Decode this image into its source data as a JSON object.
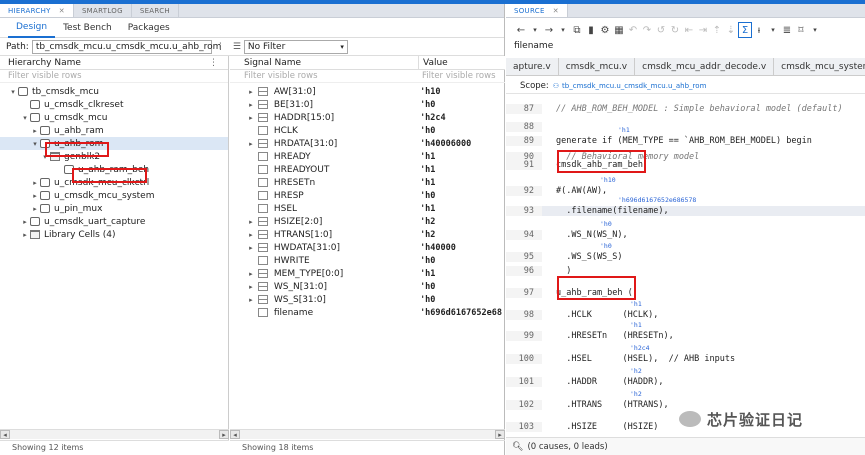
{
  "left_tabs": [
    {
      "label": "HIERARCHY",
      "active": true
    },
    {
      "label": "SMARTLOG",
      "active": false
    },
    {
      "label": "SEARCH",
      "active": false
    }
  ],
  "sub_tabs": [
    {
      "label": "Design",
      "active": true
    },
    {
      "label": "Test Bench",
      "active": false
    },
    {
      "label": "Packages",
      "active": false
    }
  ],
  "path": {
    "label": "Path:",
    "value": "tb_cmsdk_mcu.u_cmsdk_mcu.u_ahb_rom"
  },
  "filter_select": {
    "value": "No Filter"
  },
  "hierarchy": {
    "header": "Hierarchy Name",
    "filter_placeholder": "Filter visible rows",
    "items": [
      {
        "label": "tb_cmsdk_mcu",
        "depth": 0,
        "expander": "▾"
      },
      {
        "label": "u_cmsdk_clkreset",
        "depth": 1,
        "expander": ""
      },
      {
        "label": "u_cmsdk_mcu",
        "depth": 1,
        "expander": "▾"
      },
      {
        "label": "u_ahb_ram",
        "depth": 2,
        "expander": "▸"
      },
      {
        "label": "u_ahb_rom",
        "depth": 2,
        "expander": "▾"
      },
      {
        "label": "genblk2",
        "depth": 3,
        "expander": "▾"
      },
      {
        "label": "u_ahb_ram_beh",
        "depth": 4,
        "expander": ""
      },
      {
        "label": "u_cmsdk_mcu_clkctrl",
        "depth": 2,
        "expander": "▸"
      },
      {
        "label": "u_cmsdk_mcu_system",
        "depth": 2,
        "expander": "▸"
      },
      {
        "label": "u_pin_mux",
        "depth": 2,
        "expander": "▸"
      },
      {
        "label": "u_cmsdk_uart_capture",
        "depth": 1,
        "expander": "▸"
      },
      {
        "label": "Library Cells (4)",
        "depth": 1,
        "expander": "▸"
      }
    ],
    "status": "Showing 12 items"
  },
  "signals": {
    "header_name": "Signal Name",
    "header_value": "Value",
    "filter_placeholder": "Filter visible rows",
    "rows": [
      {
        "name": "AW[31:0]",
        "value": "'h10",
        "bus": true
      },
      {
        "name": "BE[31:0]",
        "value": "'h0",
        "bus": true
      },
      {
        "name": "HADDR[15:0]",
        "value": "'h2c4",
        "bus": true
      },
      {
        "name": "HCLK",
        "value": "'h0",
        "bus": false
      },
      {
        "name": "HRDATA[31:0]",
        "value": "'h40006000",
        "bus": true
      },
      {
        "name": "HREADY",
        "value": "'h1",
        "bus": false
      },
      {
        "name": "HREADYOUT",
        "value": "'h1",
        "bus": false
      },
      {
        "name": "HRESETn",
        "value": "'h1",
        "bus": false
      },
      {
        "name": "HRESP",
        "value": "'h0",
        "bus": false
      },
      {
        "name": "HSEL",
        "value": "'h1",
        "bus": false
      },
      {
        "name": "HSIZE[2:0]",
        "value": "'h2",
        "bus": true
      },
      {
        "name": "HTRANS[1:0]",
        "value": "'h2",
        "bus": true
      },
      {
        "name": "HWDATA[31:0]",
        "value": "'h40000",
        "bus": true
      },
      {
        "name": "HWRITE",
        "value": "'h0",
        "bus": false
      },
      {
        "name": "MEM_TYPE[0:0]",
        "value": "'h1",
        "bus": true
      },
      {
        "name": "WS_N[31:0]",
        "value": "'h0",
        "bus": true
      },
      {
        "name": "WS_S[31:0]",
        "value": "'h0",
        "bus": true
      },
      {
        "name": "filename",
        "value": "'h696d6167652e68",
        "bus": false
      }
    ],
    "status": "Showing 18 items"
  },
  "source": {
    "tab_label": "SOURCE",
    "filename_label": "filename",
    "file_tabs": [
      "apture.v",
      "cmsdk_mcu.v",
      "cmsdk_mcu_addr_decode.v",
      "cmsdk_mcu_syster"
    ],
    "scope_label": "Scope:",
    "scope_value": "tb_cmsdk_mcu.u_cmsdk_mcu.u_ahb_rom",
    "lines": [
      {
        "num": "87",
        "text": "// AHB_ROM_BEH_MODEL : Simple behavioral model (default)"
      },
      {
        "num": "88",
        "text": ""
      },
      {
        "num": "89",
        "text": "generate if (MEM_TYPE == `AHB_ROM_BEH_MODEL) begin"
      },
      {
        "num": "90",
        "text": "  // Behavioral memory model"
      },
      {
        "num": "91",
        "text": "cmsdk_ahb_ram_beh"
      },
      {
        "num": "92",
        "text": "#(.AW(AW),"
      },
      {
        "num": "93",
        "text": "  .filename(filename),"
      },
      {
        "num": "94",
        "text": "  .WS_N(WS_N),"
      },
      {
        "num": "95",
        "text": "  .WS_S(WS_S)"
      },
      {
        "num": "96",
        "text": "  )"
      },
      {
        "num": "97",
        "text": "u_ahb_ram_beh ("
      },
      {
        "num": "98",
        "text": "  .HCLK      (HCLK),"
      },
      {
        "num": "99",
        "text": "  .HRESETn   (HRESETn),"
      },
      {
        "num": "100",
        "text": "  .HSEL      (HSEL),  // AHB inputs"
      },
      {
        "num": "101",
        "text": "  .HADDR     (HADDR),"
      },
      {
        "num": "102",
        "text": "  .HTRANS    (HTRANS),"
      },
      {
        "num": "103",
        "text": "  .HSIZE     (HSIZE)"
      }
    ],
    "annotations": [
      "'h1",
      "'h10",
      "'h696d6167652e686578",
      "'h0",
      "'h0",
      "'h0",
      "'h1",
      "'h1",
      "'h2c4",
      "'h2",
      "'h2"
    ],
    "status": "(0 causes, 0 leads)"
  },
  "watermark": "芯片验证日记",
  "colors": {
    "accent": "#1a6fd1",
    "highlight_box": "#e01818",
    "selected_row": "#dbe7f5"
  }
}
